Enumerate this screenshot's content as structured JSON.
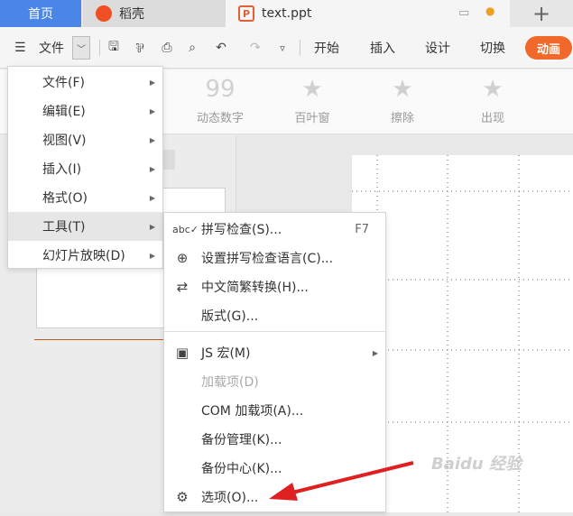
{
  "tabs": {
    "home": "首页",
    "daoke": "稻壳",
    "file": "text.ppt",
    "add": "+"
  },
  "toolbar": {
    "menu_label": "文件",
    "ribbon_tabs": [
      "开始",
      "插入",
      "设计",
      "切换"
    ],
    "active_tab": "动画"
  },
  "ribbon": {
    "effects": [
      {
        "label": "动态数字",
        "glyph": "99"
      },
      {
        "label": "百叶窗",
        "glyph": "★"
      },
      {
        "label": "擦除",
        "glyph": "★"
      },
      {
        "label": "出现",
        "glyph": "★"
      }
    ]
  },
  "menu": {
    "items": [
      {
        "label": "文件(F)"
      },
      {
        "label": "编辑(E)"
      },
      {
        "label": "视图(V)"
      },
      {
        "label": "插入(I)"
      },
      {
        "label": "格式(O)"
      },
      {
        "label": "工具(T)"
      },
      {
        "label": "幻灯片放映(D)"
      }
    ]
  },
  "submenu": {
    "items": [
      {
        "label": "拼写检查(S)...",
        "shortcut": "F7",
        "icon": "spellcheck-icon"
      },
      {
        "label": "设置拼写检查语言(C)...",
        "icon": "language-icon"
      },
      {
        "label": "中文简繁转换(H)...",
        "icon": "convert-icon"
      },
      {
        "label": "版式(G)..."
      },
      {
        "label": "JS 宏(M)",
        "icon": "macro-icon"
      },
      {
        "label": "加载项(D)"
      },
      {
        "label": "COM 加载项(A)..."
      },
      {
        "label": "备份管理(K)..."
      },
      {
        "label": "备份中心(K)..."
      },
      {
        "label": "选项(O)...",
        "icon": "gear-icon"
      }
    ]
  },
  "watermark": "Baidu 经验",
  "colors": {
    "accent": "#4a86e8",
    "anim": "#f0682a",
    "arrow": "#e02020"
  }
}
